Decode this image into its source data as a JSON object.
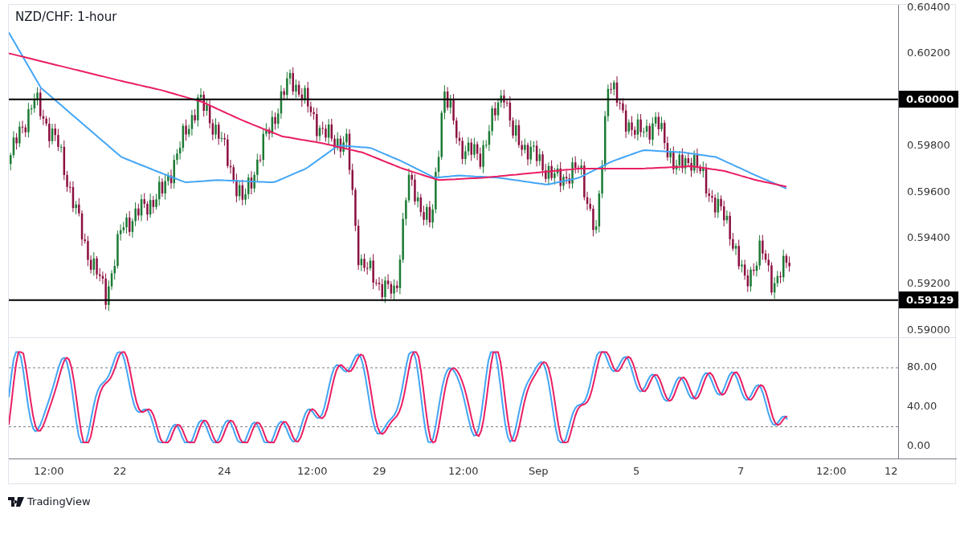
{
  "title": "NZD/CHF: 1-hour",
  "price_axis": {
    "ticks": [
      "0.60400",
      "0.60200",
      "0.59800",
      "0.59600",
      "0.59400",
      "0.59200",
      "0.59000"
    ]
  },
  "levels": [
    {
      "label": "0.60000"
    },
    {
      "label": "0.59129"
    }
  ],
  "oscillator_axis": {
    "ticks": [
      "80.00",
      "40.00",
      "0.00"
    ]
  },
  "time_axis": {
    "ticks": [
      "12:00",
      "22",
      "24",
      "12:00",
      "29",
      "12:00",
      "Sep",
      "5",
      "7",
      "12:00",
      "12"
    ]
  },
  "brand": "TradingView"
}
